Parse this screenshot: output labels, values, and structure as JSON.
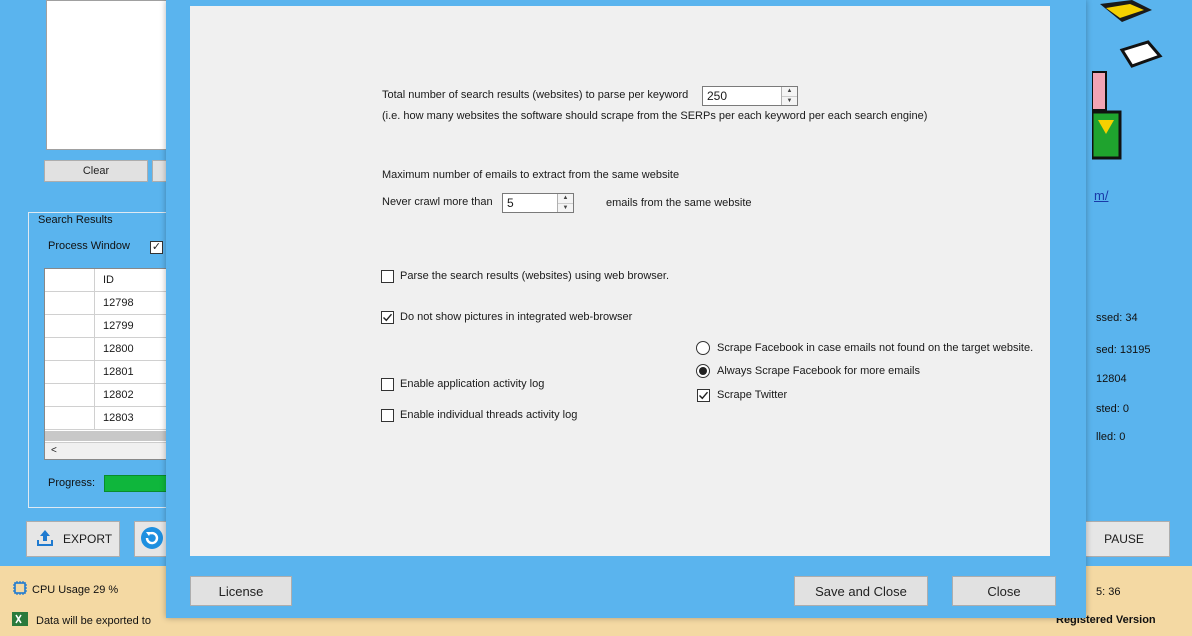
{
  "background": {
    "clear_button": "Clear",
    "search_results_title": "Search Results",
    "process_window_label": "Process Window",
    "process_window_checked": true,
    "grid": {
      "header": "ID",
      "rows": [
        "12798",
        "12799",
        "12800",
        "12801",
        "12802",
        "12803"
      ],
      "scroll_left": "<"
    },
    "progress_label": "Progress:",
    "export_button": "EXPORT",
    "pause_button": "PAUSE",
    "url_fragment": "m/",
    "stats": [
      "ssed: 34",
      "sed: 13195",
      "12804",
      "sted: 0",
      "lled: 0"
    ],
    "status": {
      "cpu_usage": "CPU Usage 29 %",
      "export_message": "Data will be exported to",
      "time_fragment": "5: 36",
      "version": "Registered Version"
    }
  },
  "dialog": {
    "search_results_label": "Total number of search results (websites) to parse per keyword",
    "search_results_value": "250",
    "search_results_hint": "(i.e. how many websites the software should scrape from the SERPs per each keyword per each search engine)",
    "max_emails_title": "Maximum number of emails to extract from the same website",
    "never_crawl_label": "Never crawl more than",
    "never_crawl_value": "5",
    "never_crawl_suffix": "emails from the same website",
    "parse_browser_label": "Parse the search results (websites) using web browser.",
    "parse_browser_checked": false,
    "no_pictures_label": "Do not show pictures in integrated web-browser",
    "no_pictures_checked": true,
    "app_log_label": "Enable application activity log",
    "app_log_checked": false,
    "thread_log_label": "Enable individual threads activity log",
    "thread_log_checked": false,
    "facebook_fallback_label": "Scrape Facebook in case emails not found on the target website.",
    "facebook_always_label": "Always Scrape Facebook for more emails",
    "facebook_selected": "always",
    "twitter_label": "Scrape Twitter",
    "twitter_checked": true,
    "license_button": "License",
    "save_close_button": "Save and Close",
    "close_button": "Close"
  }
}
